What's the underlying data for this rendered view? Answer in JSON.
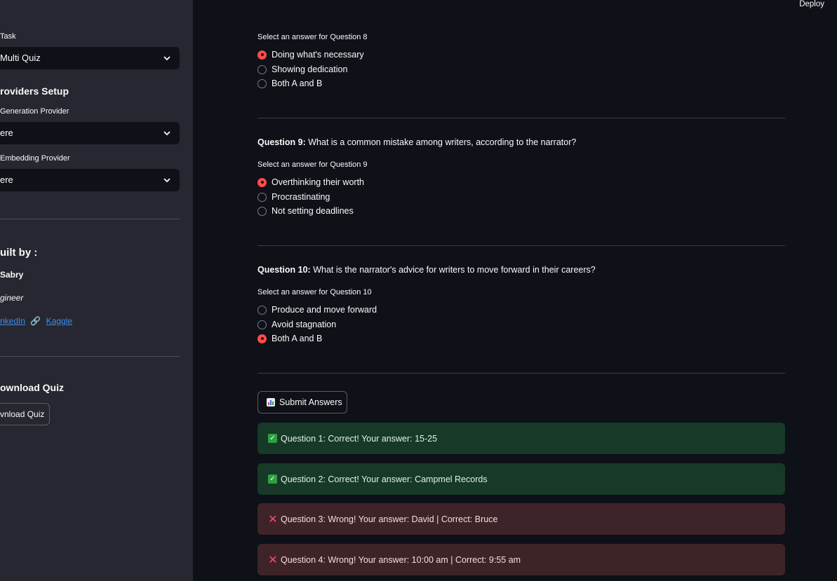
{
  "header": {
    "deploy_label": "Deploy"
  },
  "sidebar": {
    "task_label": "Task",
    "task_value": "Multi Quiz",
    "providers_heading": "roviders Setup",
    "generation_label": "Generation Provider",
    "generation_value": "ere",
    "embedding_label": "Embedding Provider",
    "embedding_value": "ere",
    "built_by_heading": "uilt by :",
    "author_name": "Sabry",
    "author_role": "gineer",
    "linkedin_label": "nkedIn",
    "link_separator_icon": "link-icon",
    "kaggle_label": "Kaggle",
    "download_heading": "ownload Quiz",
    "download_button": "vnload Quiz"
  },
  "main": {
    "q8": {
      "select_label": "Select an answer for Question 8",
      "options": [
        "Doing what's necessary",
        "Showing dedication",
        "Both A and B"
      ],
      "selected": 0
    },
    "q9": {
      "prefix": "Question 9:",
      "text": " What is a common mistake among writers, according to the narrator?",
      "select_label": "Select an answer for Question 9",
      "options": [
        "Overthinking their worth",
        "Procrastinating",
        "Not setting deadlines"
      ],
      "selected": 0
    },
    "q10": {
      "prefix": "Question 10:",
      "text": " What is the narrator's advice for writers to move forward in their careers?",
      "select_label": "Select an answer for Question 10",
      "options": [
        "Produce and move forward",
        "Avoid stagnation",
        "Both A and B"
      ],
      "selected": 2
    },
    "submit_label": "Submit Answers",
    "results": [
      {
        "status": "correct",
        "text": "Question 1: Correct! Your answer: 15-25"
      },
      {
        "status": "correct",
        "text": "Question 2: Correct! Your answer: Campmel Records"
      },
      {
        "status": "wrong",
        "text": "Question 3: Wrong! Your answer: David | Correct: Bruce"
      },
      {
        "status": "wrong",
        "text": "Question 4: Wrong! Your answer: 10:00 am | Correct: 9:55 am"
      }
    ]
  },
  "colors": {
    "accent": "#ff4b4b",
    "success_bg": "#173928",
    "error_bg": "#3e2428",
    "sidebar_bg": "#262730",
    "main_bg": "#0e1117"
  }
}
